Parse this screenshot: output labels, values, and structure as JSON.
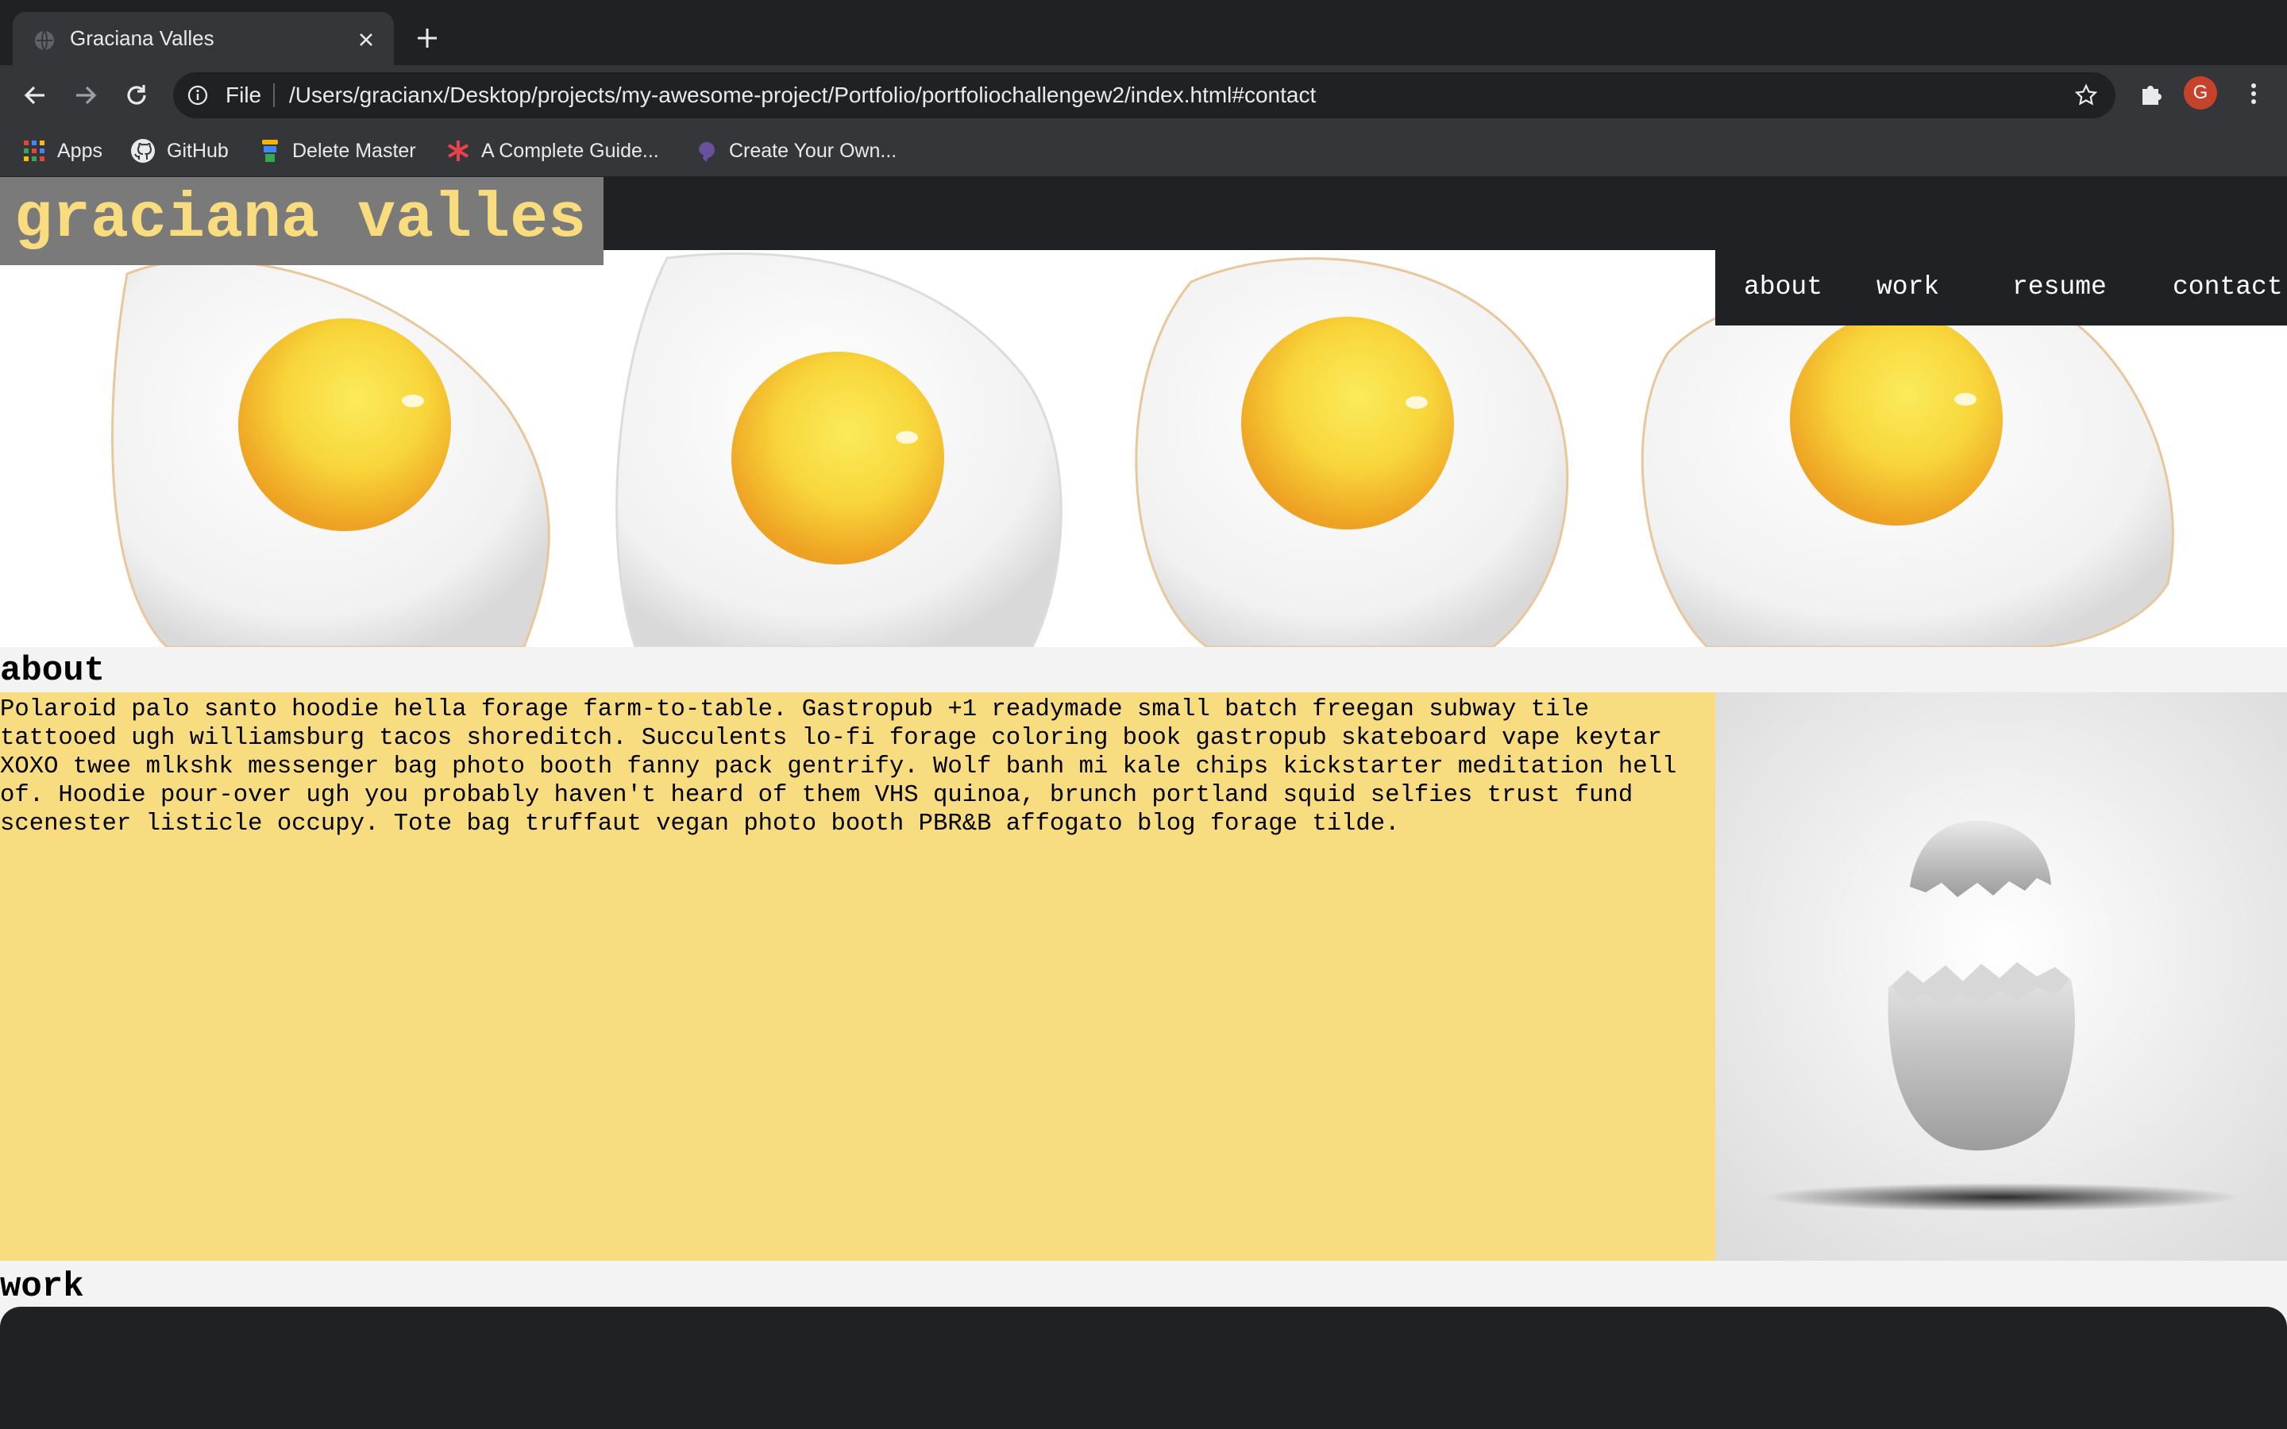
{
  "browser": {
    "tab": {
      "title": "Graciana Valles"
    },
    "omnibox": {
      "scheme": "File",
      "url": "/Users/gracianx/Desktop/projects/my-awesome-project/Portfolio/portfoliochallengew2/index.html#contact"
    },
    "profile_initial": "G",
    "bookmarks": [
      {
        "label": "Apps",
        "icon": "apps-grid-icon"
      },
      {
        "label": "GitHub",
        "icon": "github-icon"
      },
      {
        "label": "Delete Master",
        "icon": "delete-master-icon"
      },
      {
        "label": "A Complete Guide...",
        "icon": "asterisk-icon"
      },
      {
        "label": "Create Your Own...",
        "icon": "purple-logo-icon"
      }
    ]
  },
  "site": {
    "logo": "graciana valles",
    "nav": [
      "about",
      "work",
      "resume",
      "contact"
    ],
    "about": {
      "heading": "about",
      "text": "Polaroid palo santo hoodie hella forage farm-to-table. Gastropub +1 readymade small batch freegan subway tile tattooed ugh williamsburg tacos shoreditch. Succulents lo-fi forage coloring book gastropub skateboard vape keytar XOXO twee mlkshk messenger bag photo booth fanny pack gentrify. Wolf banh mi kale chips kickstarter meditation hell of. Hoodie pour-over ugh you probably haven't heard of them VHS quinoa, brunch portland squid selfies trust fund scenester listicle occupy. Tote bag truffaut vegan photo booth PBR&B affogato blog forage tilde."
    },
    "work": {
      "heading": "work"
    }
  },
  "colors": {
    "chrome_dark": "#202124",
    "chrome_toolbar": "#35363a",
    "logo_bg": "#7a7a7a",
    "logo_text": "#f9dc7d",
    "about_bg": "#f8dc80",
    "yolk": "#f7c62d"
  }
}
